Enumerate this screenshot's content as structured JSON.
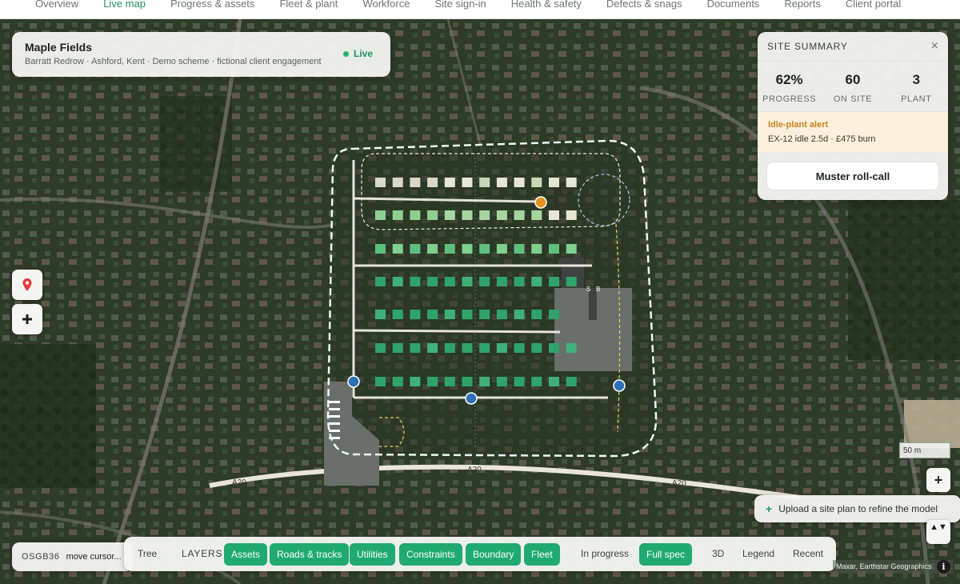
{
  "nav": {
    "items": [
      "Overview",
      "Live map",
      "Progress & assets",
      "Fleet & plant",
      "Workforce",
      "Site sign-in",
      "Health & safety",
      "Defects & snags",
      "Documents",
      "Reports",
      "Client portal"
    ],
    "active_index": 1
  },
  "site": {
    "name": "Maple Fields",
    "subtitle": "Barratt Redrow · Ashford, Kent · Demo scheme · fictional client engagement",
    "status": "Live"
  },
  "summary": {
    "title": "SITE SUMMARY",
    "close": "×",
    "stats": [
      {
        "value": "62%",
        "label": "PROGRESS"
      },
      {
        "value": "60",
        "label": "ON SITE"
      },
      {
        "value": "3",
        "label": "PLANT"
      }
    ],
    "alert_title": "Idle-plant alert",
    "alert_detail": "EX-12 idle 2.5d · £475 burn",
    "muster_label": "Muster roll-call"
  },
  "map": {
    "road_label": "A20",
    "block_labels": [
      "B",
      "B",
      "S",
      "B"
    ],
    "scale_label": "50 m",
    "attribution": "Maxar, Earthstar Geographics",
    "colors": {
      "boundary": "#e8fff0",
      "built": "#2fa36a",
      "in_progress": "#8fcf8f",
      "planned": "#e6e6d2",
      "plant": "#e3941e",
      "worker": "#2f6fb8"
    }
  },
  "controls": {
    "pin_icon": "map-pin-icon",
    "add_icon": "plus-icon",
    "zoom_in": "+",
    "compass": "▲▼",
    "upload_label": "Upload a site plan to refine the model",
    "upload_plus": "+"
  },
  "coords": {
    "grid": "OSGB36",
    "cursor": "move cursor..."
  },
  "layers": {
    "tree_label": "Tree",
    "layers_label": "LAYERS",
    "chips": [
      "Assets",
      "Roads & tracks",
      "Utilities",
      "Constraints",
      "Boundary",
      "Fleet"
    ],
    "mode_inactive": "In progress",
    "mode_active": "Full spec",
    "view_3d": "3D",
    "legend": "Legend",
    "recent": "Recent"
  },
  "info_icon": "i"
}
